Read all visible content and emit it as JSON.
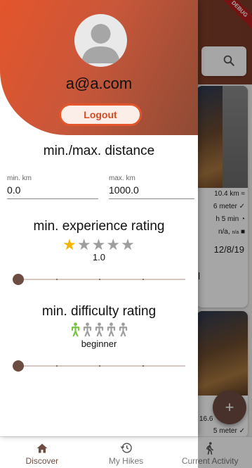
{
  "background": {
    "debug_banner": "DEBUG",
    "card1": {
      "distance": "10.4 km",
      "elevation": "6 meter",
      "duration": "h 5 min",
      "rating": "n/a,",
      "rating_small": "n/a",
      "date": "12/8/19",
      "name_fragment": "l"
    },
    "card2": {
      "distance": "16.6",
      "elevation": "5 meter"
    },
    "fab_label": "+"
  },
  "drawer": {
    "email": "a@a.com",
    "logout_label": "Logout",
    "distance": {
      "title": "min./max. distance",
      "min_label": "min. km",
      "min_value": "0.0",
      "max_label": "max. km",
      "max_value": "1000.0"
    },
    "experience": {
      "title": "min. experience rating",
      "value_text": "1.0",
      "stars_total": 5,
      "stars_filled": 1,
      "slider_fraction": 0
    },
    "difficulty": {
      "title": "min. difficulty rating",
      "value_text": "beginner",
      "hikers_total": 5,
      "hikers_filled": 1,
      "slider_fraction": 0
    },
    "colors": {
      "header_start": "#e4552b",
      "header_end": "#8e4a35",
      "accent_brown": "#6d4c41",
      "star_active": "#f4b400",
      "hiker_active": "#7cc243",
      "inactive": "#9e9e9e"
    }
  },
  "bottom_nav": {
    "items": [
      {
        "label": "Discover",
        "icon": "home-icon",
        "active": true
      },
      {
        "label": "My Hikes",
        "icon": "history-icon",
        "active": false
      },
      {
        "label": "Current Activity",
        "icon": "walking-icon",
        "active": false
      }
    ]
  }
}
